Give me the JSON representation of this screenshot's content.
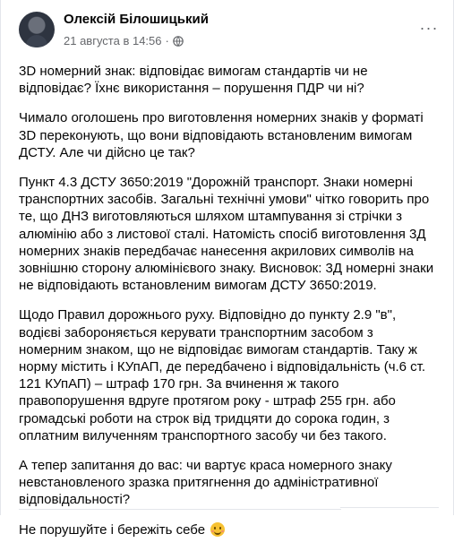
{
  "post": {
    "author": "Олексій Білошицький",
    "timestamp": "21 августа в 14:56",
    "dot": "·",
    "more_label": "···",
    "paragraphs": [
      "3D номерний знак: відповідає вимогам стандартів чи не відповідає? Їхнє використання – порушення ПДР чи ні?",
      "Чимало оголошень про виготовлення номерних знаків у форматі 3D переконують, що вони відповідають встановленим вимогам ДСТУ. Але чи дійсно це так?",
      "Пункт 4.3 ДСТУ 3650:2019 \"Дорожній транспорт. Знаки номерні транспортних засобів. Загальні технічні умови\" чітко говорить про те, що ДНЗ виготовляються шляхом штампування зі стрічки з алюмінію або з листової сталі. Натомість спосіб виготовлення 3Д номерних знаків передбачає нанесення акрилових символів на зовнішню сторону алюмінієвого знаку. Висновок: 3Д номерні знаки не відповідають встановленим вимогам ДСТУ 3650:2019.",
      "Щодо Правил дорожнього руху. Відповідно до пункту 2.9 \"в\", водієві забороняється керувати транспортним засобом з номерним знаком, що не відповідає вимогам стандартів. Таку ж норму містить і КУпАП, де передбачено і відповідальність (ч.6 ст. 121 КУпАП) – штраф 170 грн. За вчинення ж такого правопорушення вдруге протягом року - штраф 255 грн. або громадські роботи на строк від тридцяти до сорока годин, з оплатним вилученням транспортного засобу чи без такого.",
      "А тепер запитання до вас: чи вартує краса номерного знаку невстановленого зразка притягнення до адміністративної відповідальності?",
      "Не порушуйте і бережіть себе"
    ],
    "emoji": "smiling-face-with-blush-emoji"
  },
  "colors": {
    "text": "#050505",
    "secondary": "#65676b",
    "border": "#e4e6eb"
  }
}
